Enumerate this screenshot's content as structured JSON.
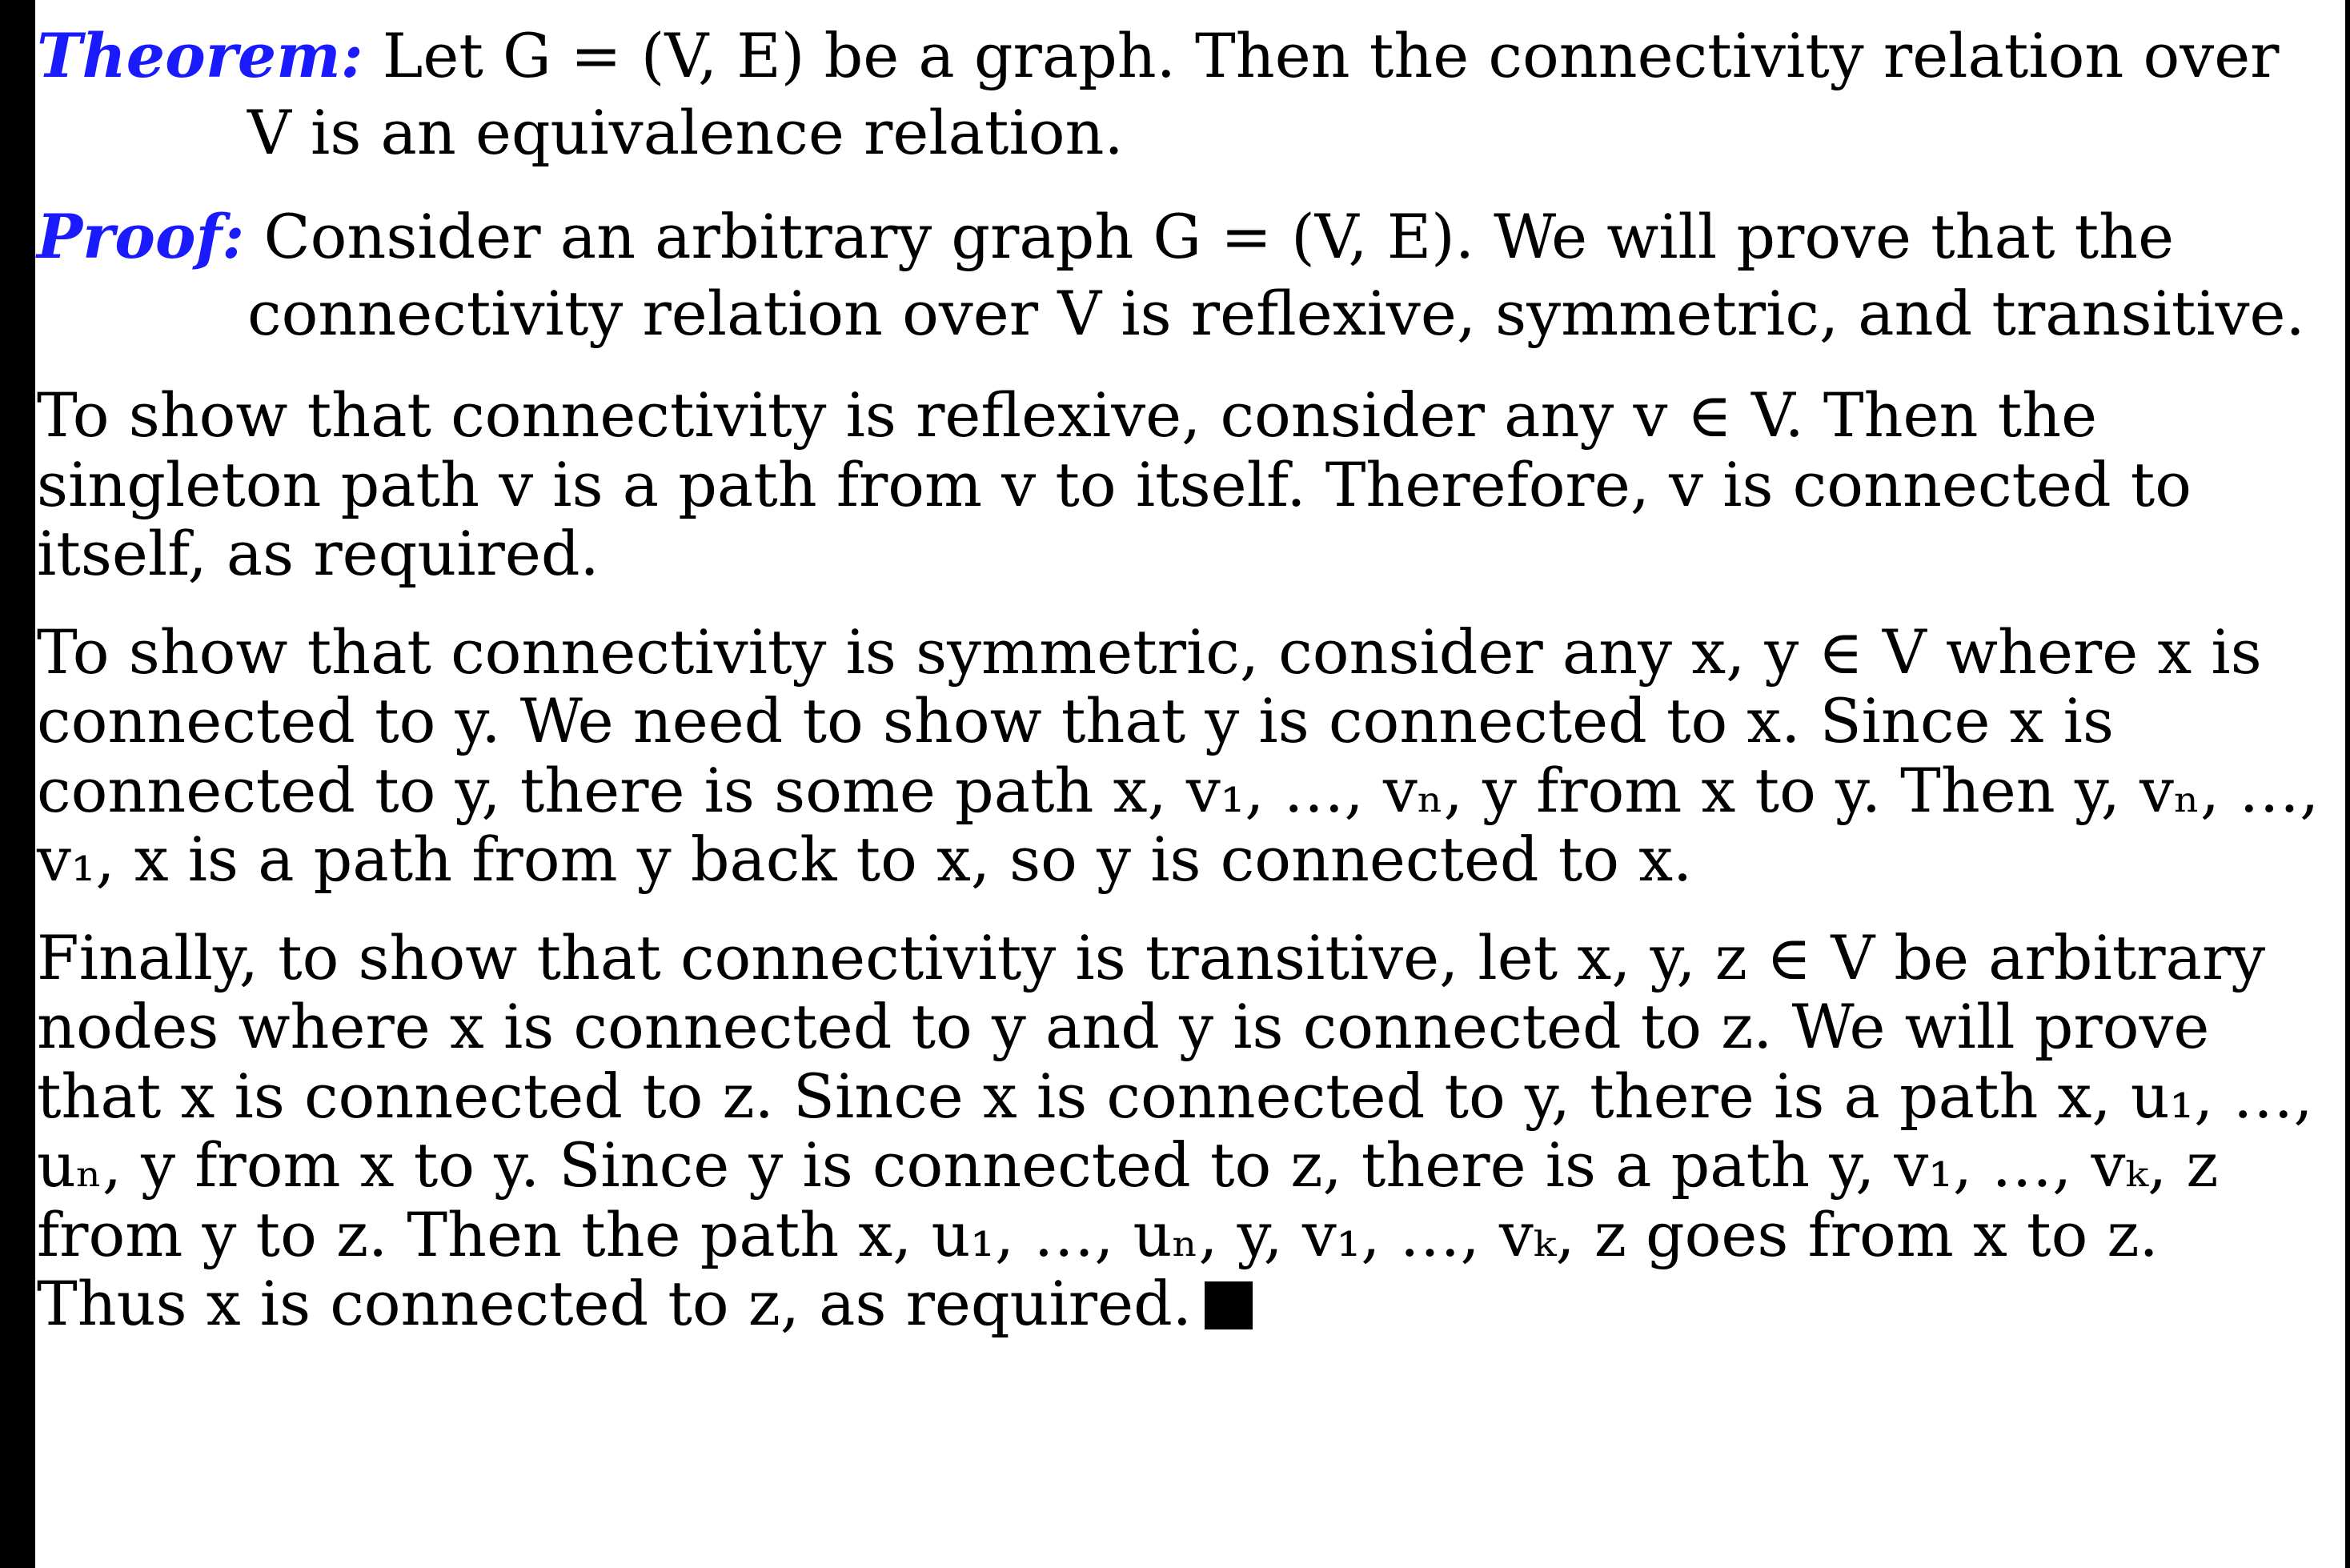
{
  "theorem": {
    "label": "Theorem:",
    "text": " Let G = (V, E) be a graph. Then the connectivity relation over V is an equivalence relation."
  },
  "proof": {
    "label": "Proof:",
    "text": " Consider an arbitrary graph G = (V, E). We will prove that the connectivity relation over V is reflexive, symmetric, and transitive."
  },
  "paragraphs": {
    "reflexive": "To show that connectivity is reflexive, consider any v ∈ V. Then the singleton path v is a path from v to itself. Therefore, v is connected to itself, as required.",
    "symmetric": "To show that connectivity is symmetric, consider any x, y ∈ V where x is connected to y. We need to show that y is connected to x. Since x is connected to y, there is some path x, v₁, …, vₙ, y from x to y. Then y, vₙ, …, v₁, x is a path from y back to x, so y is connected to x.",
    "transitive": "Finally, to show that connectivity is transitive, let x, y, z ∈ V be arbitrary nodes where x is connected to y and y is connected to z. We will prove that x is connected to z. Since x is connected to y, there is a path x, u₁, …, uₙ, y from x to y. Since y is connected to z, there is a path y, v₁, …, vₖ, z from y to z. Then the path x, u₁, …, uₙ, y, v₁, …, vₖ, z goes from x to z. Thus x is connected to z, as required."
  },
  "qed_symbol": "qed-square",
  "colors": {
    "keyword": "#1a1aff",
    "text": "#000000",
    "border": "#000000"
  }
}
